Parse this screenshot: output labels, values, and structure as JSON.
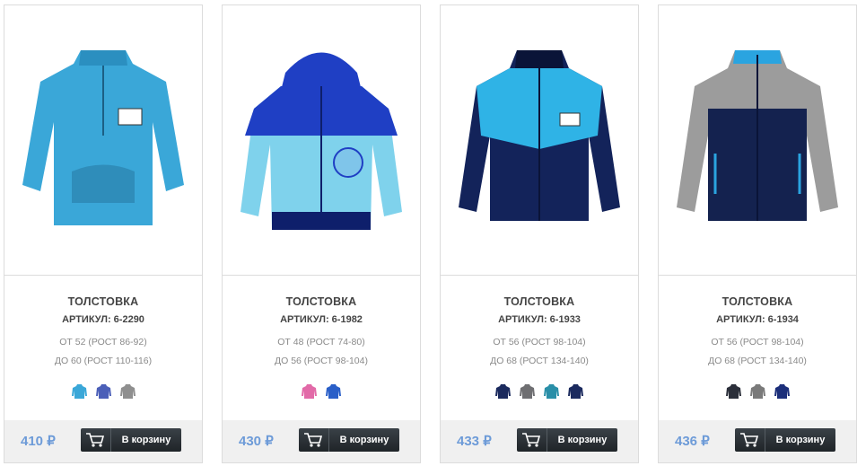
{
  "products": [
    {
      "title": "ТОЛСТОВКА",
      "sku": "АРТИКУЛ: 6-2290",
      "size_from": "ОТ 52 (РОСТ 86-92)",
      "size_to": "ДО 60 (РОСТ 110-116)",
      "price": "410 ₽",
      "button": "В корзину",
      "colors": {
        "body": "#3aa7d8",
        "trim": "#2b8fc0",
        "accent": "#1c5f84"
      },
      "swatches": [
        "#3aa7d8",
        "#4b5fb8",
        "#8f8f8f"
      ]
    },
    {
      "title": "ТОЛСТОВКА",
      "sku": "АРТИКУЛ: 6-1982",
      "size_from": "ОТ 48 (РОСТ 74-80)",
      "size_to": "ДО 56 (РОСТ 98-104)",
      "price": "430 ₽",
      "button": "В корзину",
      "colors": {
        "body": "#7fd2ec",
        "trim": "#1f3fc4",
        "accent": "#0e1f6b"
      },
      "swatches": [
        "#e26aa8",
        "#2a5fc8"
      ]
    },
    {
      "title": "ТОЛСТОВКА",
      "sku": "АРТИКУЛ: 6-1933",
      "size_from": "ОТ 56 (РОСТ 98-104)",
      "size_to": "ДО 68 (РОСТ 134-140)",
      "price": "433 ₽",
      "button": "В корзину",
      "colors": {
        "body": "#13235a",
        "trim": "#2fb3e6",
        "accent": "#0a1438"
      },
      "swatches": [
        "#1b2a5e",
        "#6f6f72",
        "#2a8fa8",
        "#1b2a5e"
      ]
    },
    {
      "title": "ТОЛСТОВКА",
      "sku": "АРТИКУЛ: 6-1934",
      "size_from": "ОТ 56 (РОСТ 98-104)",
      "size_to": "ДО 68 (РОСТ 134-140)",
      "price": "436 ₽",
      "button": "В корзину",
      "colors": {
        "body": "#14224f",
        "trim": "#9c9c9c",
        "accent": "#2aa4e0"
      },
      "swatches": [
        "#2b2f3a",
        "#7a7a7a",
        "#1c2f7a"
      ]
    }
  ]
}
